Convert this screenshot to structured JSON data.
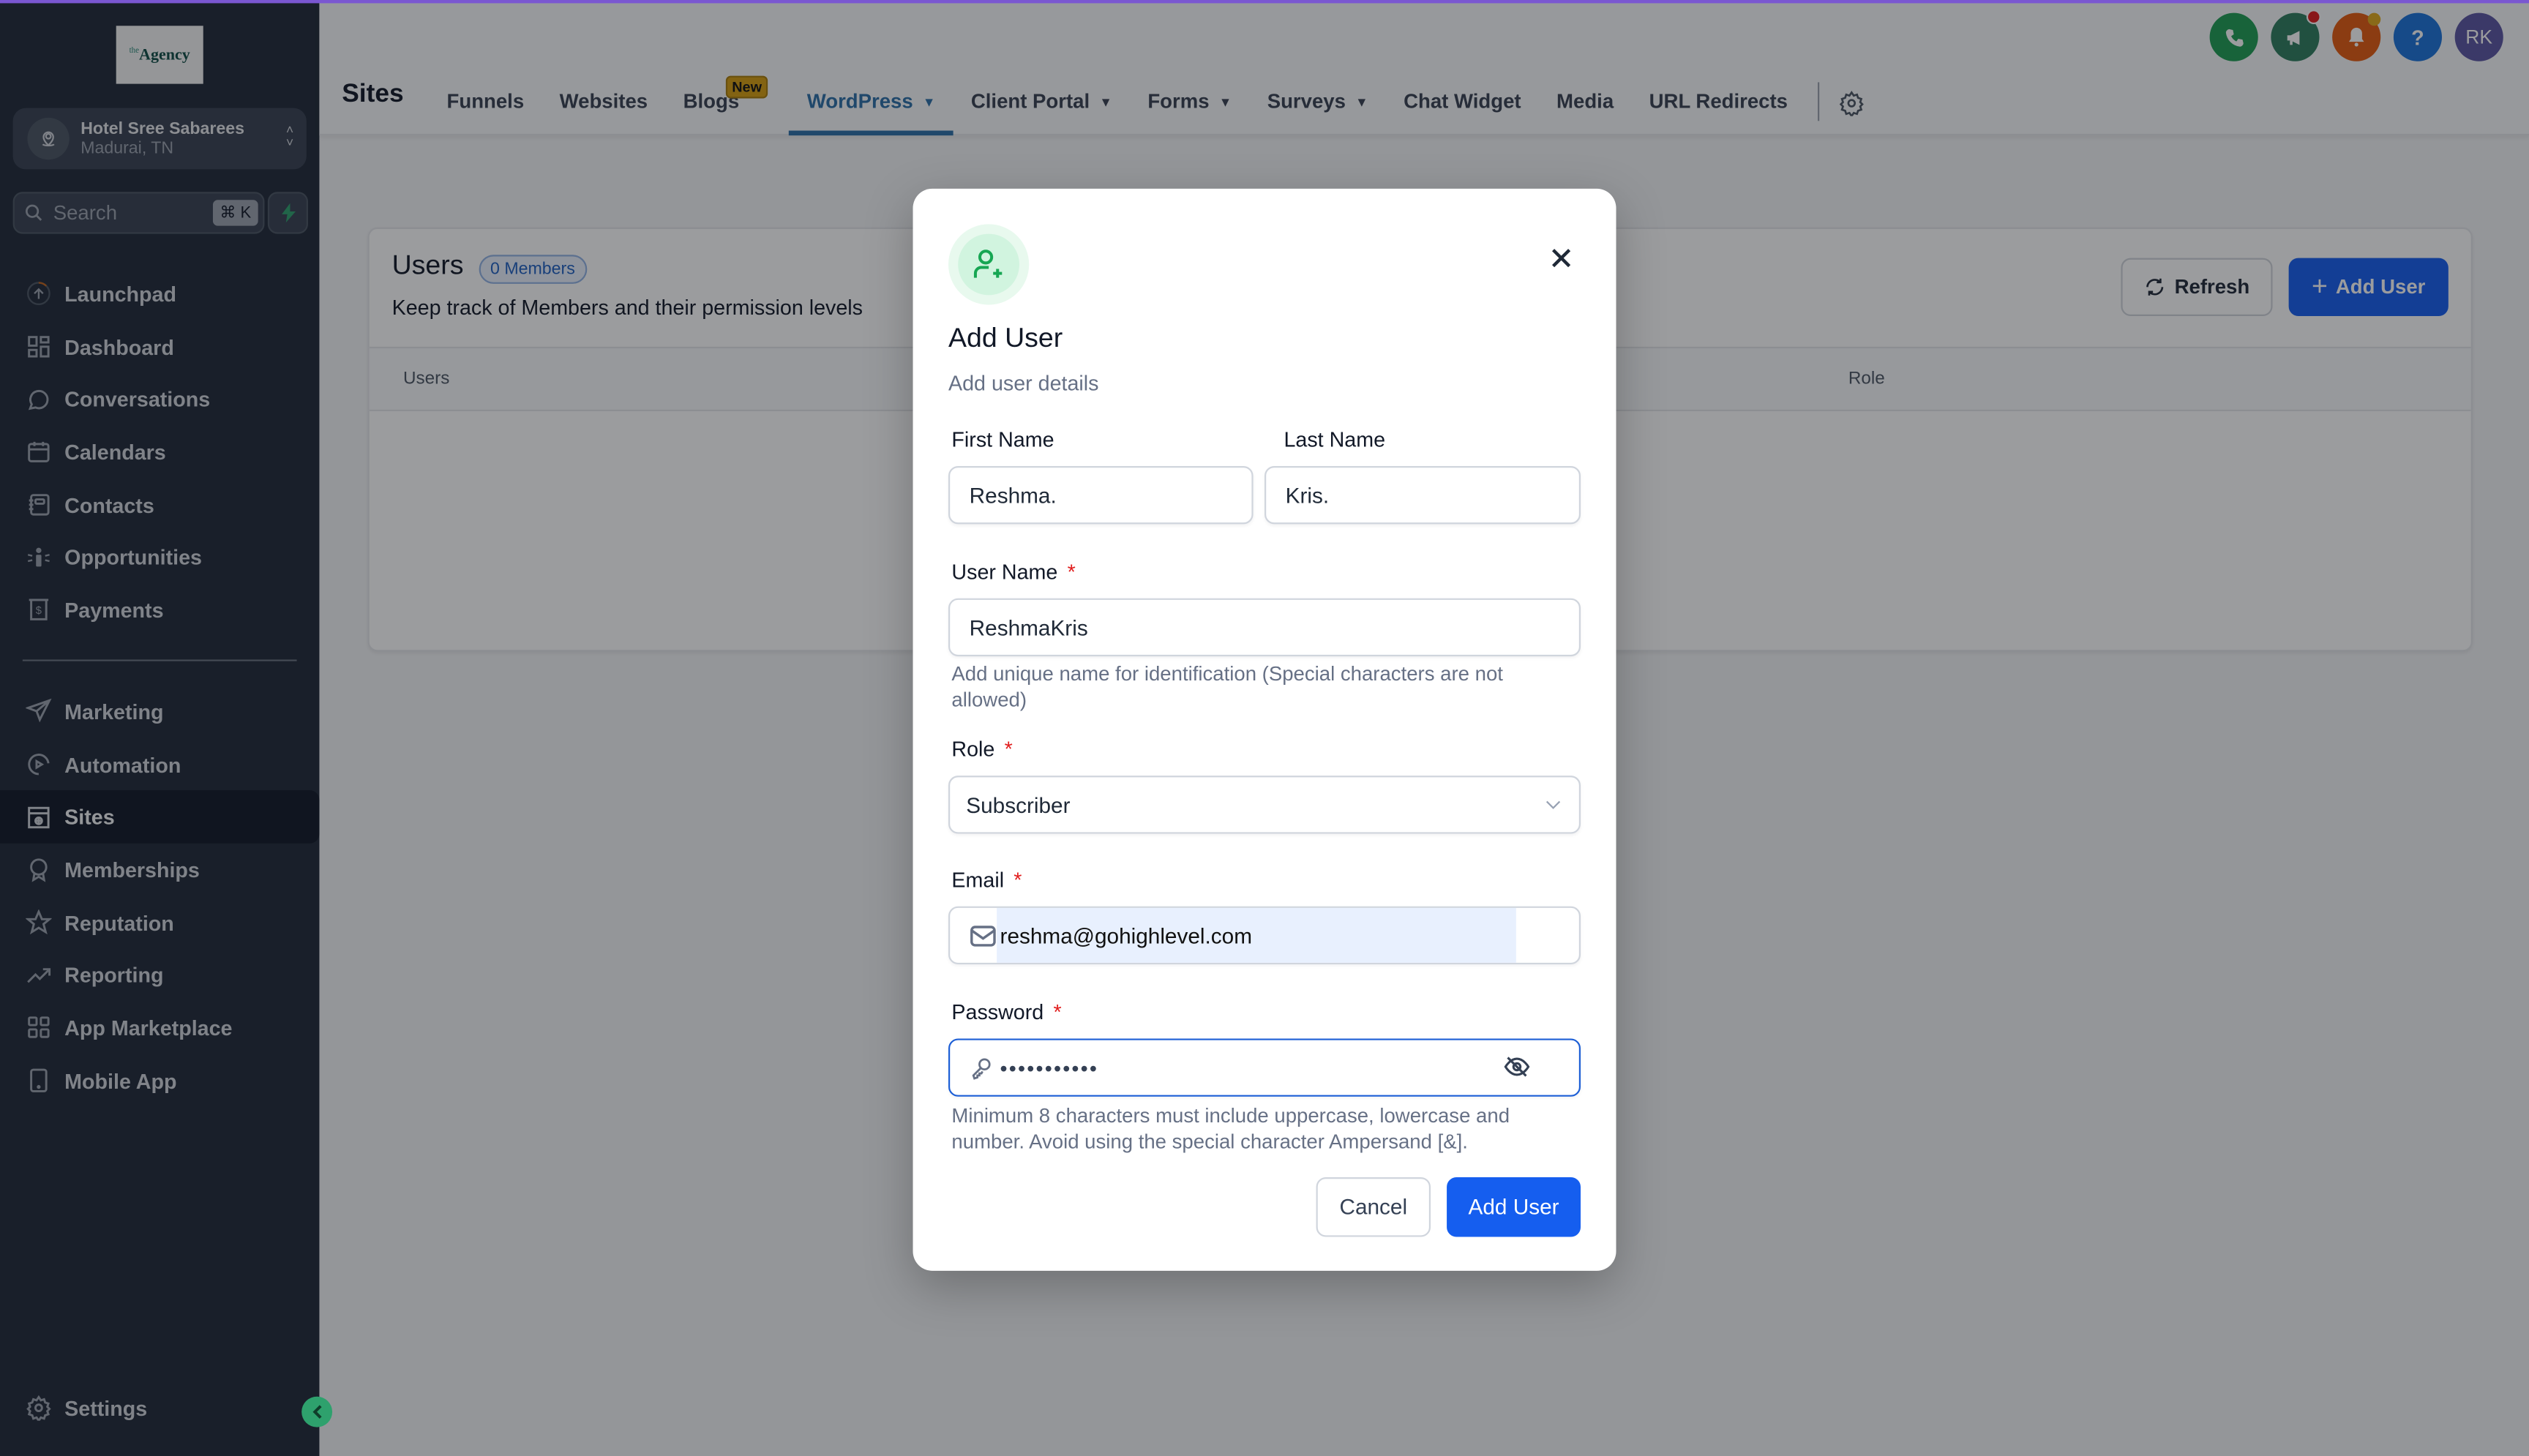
{
  "sidebar": {
    "logo_text": "Agency",
    "logo_prefix": "the",
    "location": {
      "name": "Hotel Sree Sabarees",
      "city": "Madurai, TN"
    },
    "search": {
      "placeholder": "Search",
      "shortcut": "⌘ K"
    },
    "items": [
      {
        "label": "Launchpad",
        "icon": "launchpad-icon"
      },
      {
        "label": "Dashboard",
        "icon": "dashboard-icon"
      },
      {
        "label": "Conversations",
        "icon": "chat-icon"
      },
      {
        "label": "Calendars",
        "icon": "calendar-icon"
      },
      {
        "label": "Contacts",
        "icon": "contacts-icon"
      },
      {
        "label": "Opportunities",
        "icon": "opportunities-icon"
      },
      {
        "label": "Payments",
        "icon": "payments-icon"
      }
    ],
    "items2": [
      {
        "label": "Marketing",
        "icon": "send-icon"
      },
      {
        "label": "Automation",
        "icon": "automation-icon"
      },
      {
        "label": "Sites",
        "icon": "sites-icon",
        "active": true
      },
      {
        "label": "Memberships",
        "icon": "badge-icon"
      },
      {
        "label": "Reputation",
        "icon": "star-icon"
      },
      {
        "label": "Reporting",
        "icon": "trend-icon"
      },
      {
        "label": "App Marketplace",
        "icon": "grid-icon"
      },
      {
        "label": "Mobile App",
        "icon": "mobile-icon"
      }
    ],
    "settings_label": "Settings"
  },
  "header": {
    "title": "Sites",
    "tabs": [
      {
        "label": "Funnels"
      },
      {
        "label": "Websites"
      },
      {
        "label": "Blogs",
        "badge": "New"
      },
      {
        "label": "WordPress",
        "dropdown": true,
        "active": true
      },
      {
        "label": "Client Portal",
        "dropdown": true
      },
      {
        "label": "Forms",
        "dropdown": true
      },
      {
        "label": "Surveys",
        "dropdown": true
      },
      {
        "label": "Chat Widget"
      },
      {
        "label": "Media"
      },
      {
        "label": "URL Redirects"
      }
    ],
    "avatar_initials": "RK",
    "colors": {
      "phone": "#1e9e53",
      "announce": "#2e7d5e",
      "bell": "#e35a0f",
      "help": "#1a73d9",
      "avatar": "#5b55a3"
    }
  },
  "users_card": {
    "title": "Users",
    "members_badge": "0 Members",
    "description": "Keep track of Members and their permission levels",
    "refresh_label": "Refresh",
    "add_user_label": "Add User",
    "columns": [
      "Users",
      "Role"
    ]
  },
  "modal": {
    "title": "Add User",
    "subtitle": "Add user details",
    "first_name": {
      "label": "First Name",
      "value": "Reshma."
    },
    "last_name": {
      "label": "Last Name",
      "value": "Kris."
    },
    "user_name": {
      "label": "User Name",
      "value": "ReshmaKris",
      "hint": "Add unique name for identification (Special characters are not allowed)"
    },
    "role": {
      "label": "Role",
      "value": "Subscriber"
    },
    "email": {
      "label": "Email",
      "value": "reshma@gohighlevel.com"
    },
    "password": {
      "label": "Password",
      "value": "•••••••••••",
      "hint": "Minimum 8 characters must include uppercase, lowercase and number. Avoid using the special character Ampersand [&]."
    },
    "required_mark": "*",
    "cancel_label": "Cancel",
    "submit_label": "Add User"
  }
}
